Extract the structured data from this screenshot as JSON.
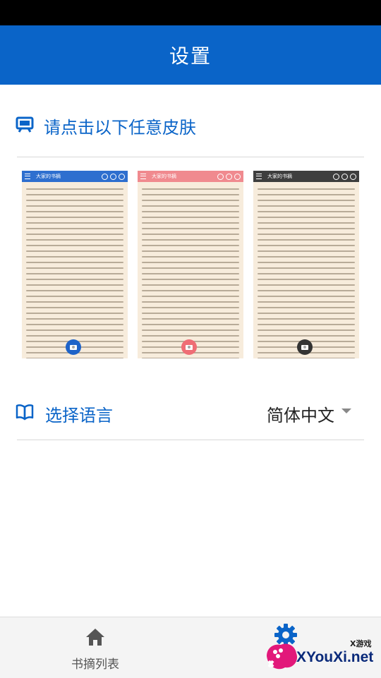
{
  "header": {
    "title": "设置"
  },
  "skin_section": {
    "label": "请点击以下任意皮肤",
    "icon": "monitor-icon"
  },
  "skins": [
    {
      "bar_color": "#2e6fcf",
      "fab_color": "#1e63c8",
      "title": "大家的书摘"
    },
    {
      "bar_color": "#f08a8f",
      "fab_color": "#ef6d75",
      "title": "大家的书摘"
    },
    {
      "bar_color": "#3e3e3e",
      "fab_color": "#333333",
      "title": "大家的书摘"
    }
  ],
  "language": {
    "label": "选择语言",
    "icon": "book-icon",
    "selected": "简体中文"
  },
  "bottom_nav": [
    {
      "label": "书摘列表",
      "icon": "home-icon"
    },
    {
      "label": "",
      "icon": "gear-icon"
    }
  ],
  "watermark": {
    "brand": "XYouXi.net",
    "sub": "X游戏"
  },
  "colors": {
    "primary": "#0a64c8",
    "divider": "#d8d8d8",
    "paper": "#f7ecdc"
  }
}
